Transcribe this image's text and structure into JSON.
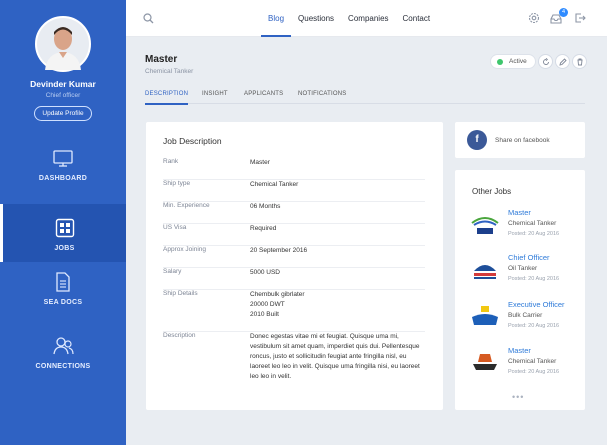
{
  "user": {
    "name": "Devinder Kumar",
    "role": "Chief officer",
    "update_label": "Update Profile"
  },
  "sidebar": {
    "items": [
      {
        "label": "DASHBOARD",
        "icon": "monitor-icon",
        "active": false
      },
      {
        "label": "JOBS",
        "icon": "jobs-grid-icon",
        "active": true
      },
      {
        "label": "SEA DOCS",
        "icon": "document-icon",
        "active": false
      },
      {
        "label": "CONNECTIONS",
        "icon": "connections-icon",
        "active": false
      }
    ]
  },
  "topnav": {
    "links": [
      "Blog",
      "Questions",
      "Companies",
      "Contact"
    ],
    "active": "Blog",
    "notification_count": "4"
  },
  "job": {
    "title": "Master",
    "vessel": "Chemical Tanker",
    "status": "Active"
  },
  "tabs": {
    "items": [
      "DESCRIPTION",
      "INSIGHT",
      "APPLICANTS",
      "NOTIFICATIONS"
    ],
    "active": "DESCRIPTION"
  },
  "description": {
    "title": "Job Description",
    "rows": [
      {
        "label": "Rank",
        "value": "Master"
      },
      {
        "label": "Ship type",
        "value": "Chemical Tanker"
      },
      {
        "label": "Min. Experience",
        "value": "06 Months"
      },
      {
        "label": "US Visa",
        "value": "Required"
      },
      {
        "label": "Approx Joining",
        "value": "20 September 2016"
      },
      {
        "label": "Salary",
        "value": "5000 USD"
      },
      {
        "label": "Ship Details",
        "value_lines": [
          "Chembulk gibrlater",
          "20000 DWT",
          "2010 Built"
        ]
      },
      {
        "label": "Description",
        "value": "Donec egestas vitae mi et feugiat. Quisque uma mi, vestibulum sit amet quam, imperdiet quis dui. Pellentesque roncus, justo et sollicitudin feugiat ante fringilla nisl, eu laoreet leo leo in velit. Quisque uma fringilla nisi, eu laoreet leo leo in velit."
      }
    ]
  },
  "share": {
    "label": "Share on facebook"
  },
  "other_jobs": {
    "title": "Other Jobs",
    "items": [
      {
        "title": "Master",
        "company": "Chemical Tanker",
        "date": "Posted: 20 Aug 2016",
        "logo": "mercy-ships"
      },
      {
        "title": "Chief Officer",
        "company": "Oil Tanker",
        "date": "Posted: 20 Aug 2016",
        "logo": "hurtigruten"
      },
      {
        "title": "Executive Officer",
        "company": "Bulk Carrier",
        "date": "Posted: 20 Aug 2016",
        "logo": "costa"
      },
      {
        "title": "Master",
        "company": "Chemical Tanker",
        "date": "Posted: 20 Aug 2016",
        "logo": "ship-line"
      }
    ],
    "more": "•••"
  },
  "colors": {
    "sidebar": "#2f62c3",
    "accent": "#2f62c3",
    "active_status": "#3ec66c",
    "link": "#2f7bd9"
  }
}
